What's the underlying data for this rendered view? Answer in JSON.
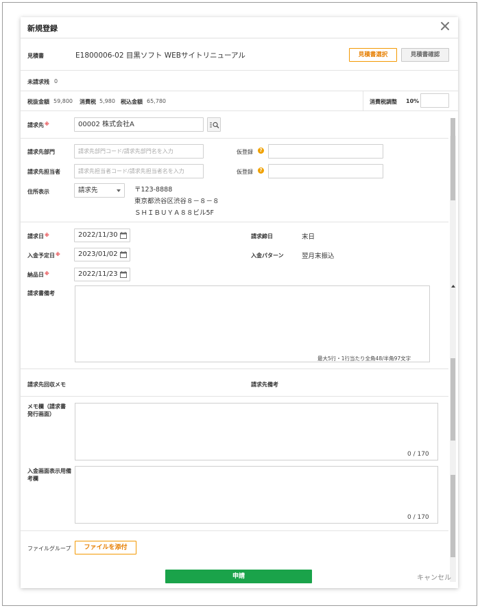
{
  "dialog": {
    "title": "新規登録"
  },
  "estimate": {
    "label": "見積書",
    "value": "E1800006-02 目黒ソフト WEBサイトリニューアル",
    "select_button": "見積書選択",
    "confirm_button": "見積書確認"
  },
  "unbilled": {
    "label": "未請求残",
    "value": "0"
  },
  "amounts": {
    "pretax_label": "税抜金額",
    "pretax_value": "59,800",
    "tax_label": "消費税",
    "tax_value": "5,980",
    "total_label": "税込金額",
    "total_value": "65,780",
    "tax_adjust_label": "消費税調整",
    "tax_rate": "10%",
    "tax_adjust_value": ""
  },
  "billing": {
    "client_label": "請求先",
    "client_value": "00002 株式会社A",
    "dept_label": "請求先部門",
    "dept_placeholder": "請求先部門コード/請求先部門名を入力",
    "person_label": "請求先担当者",
    "person_placeholder": "請求先担当者コード/請求先担当者名を入力",
    "temp_label_1": "仮登録",
    "temp_label_2": "仮登録",
    "address_label": "住所表示",
    "address_select": "請求先",
    "address_lines": [
      "〒123-8888",
      "東京都渋谷区渋谷８－８－８",
      "ＳＨＩＢＵＹＡ８８ビル5F"
    ]
  },
  "dates": {
    "invoice_date_label": "請求日",
    "invoice_date": "2022/11/30",
    "payment_date_label": "入金予定日",
    "payment_date": "2023/01/02",
    "delivery_date_label": "納品日",
    "delivery_date": "2022/11/23",
    "closing_label": "請求締日",
    "closing_value": "末日",
    "pattern_label": "入金パターン",
    "pattern_value": "翌月末振込"
  },
  "remarks": {
    "invoice_remarks_label": "請求書備考",
    "invoice_remarks_hint": "最大5行・1行当たり全角48/半角97文字",
    "collection_memo_label": "請求先回収メモ",
    "client_remarks_label": "請求先備考",
    "memo_label": "メモ欄（請求書発行画面）",
    "memo_counter": "0 / 170",
    "payment_remarks_label": "入金画面表示用備考欄",
    "payment_counter": "0 / 170"
  },
  "files": {
    "label": "ファイルグループ",
    "attach_button": "ファイルを添付"
  },
  "footer": {
    "submit": "申請",
    "cancel": "キャンセル"
  }
}
